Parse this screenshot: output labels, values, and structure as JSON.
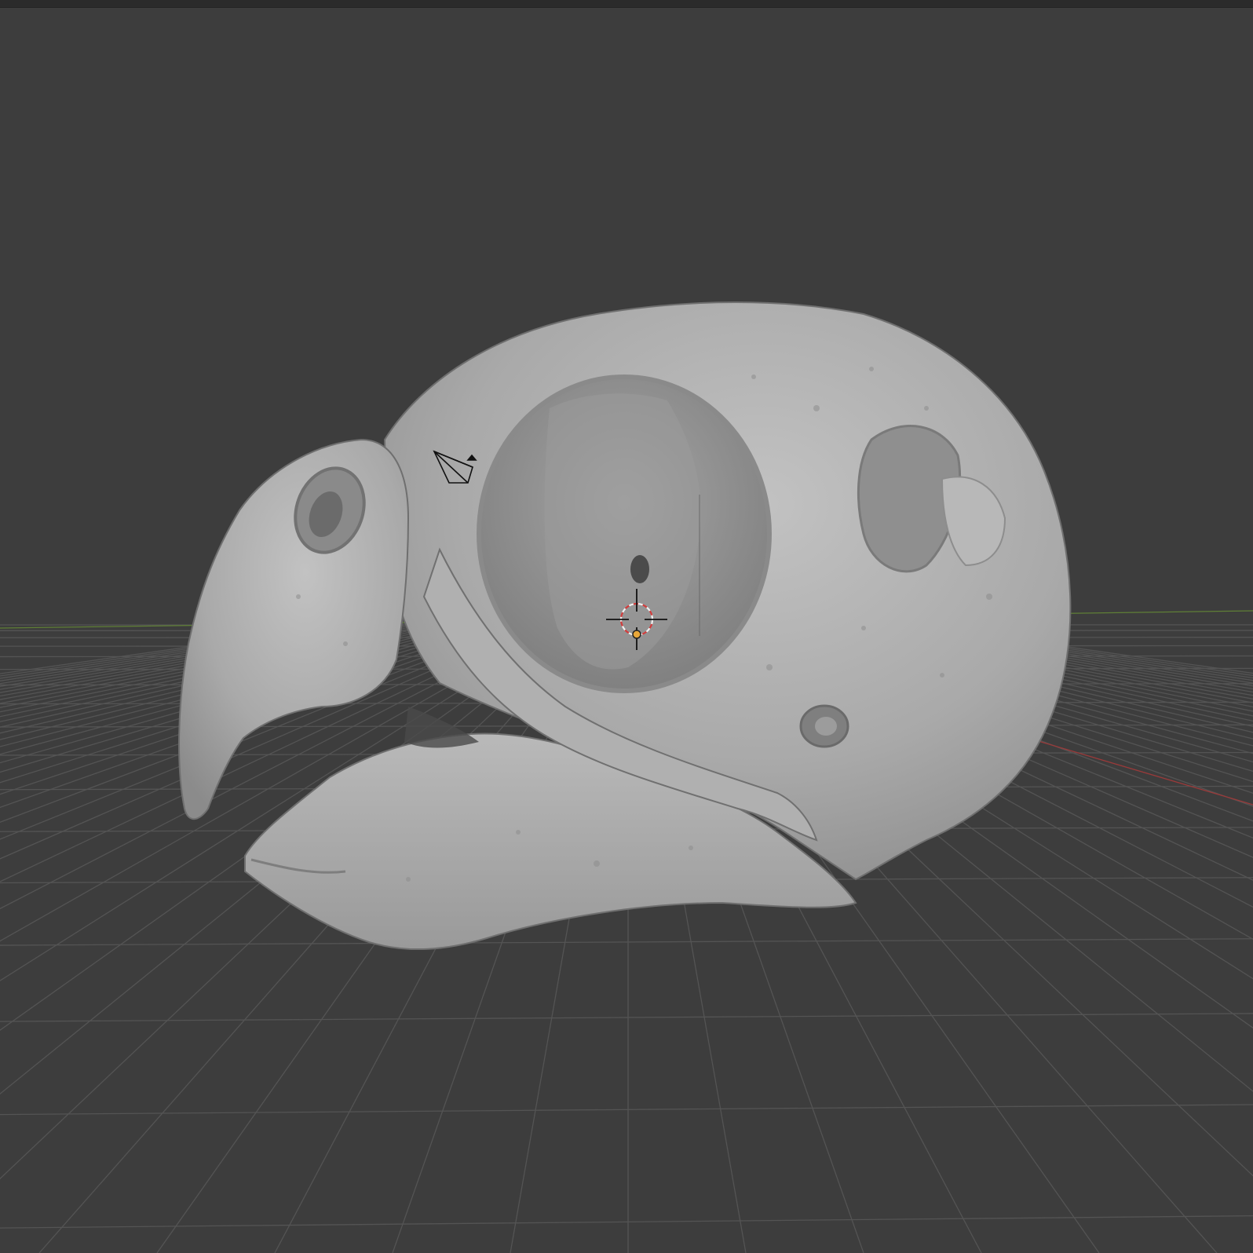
{
  "app": {
    "name": "3D viewport",
    "mode": "object",
    "shading": "solid"
  },
  "viewport": {
    "background_color": "#3d3d3d",
    "grid_color": "#545454",
    "x_axis_color": "#9a3a3a",
    "y_axis_color": "#5f7f36",
    "mesh_color": "#a9a9a9"
  },
  "scene": {
    "objects": [
      {
        "kind": "mesh",
        "icon": "skull-mesh",
        "selected": false
      },
      {
        "kind": "camera",
        "icon": "camera-icon",
        "selected": false
      },
      {
        "kind": "light",
        "icon": "light-icon",
        "selected": false
      }
    ],
    "cursor": {
      "icon": "3d-cursor-icon",
      "ring_colors": [
        "#d23c3c",
        "#f0f0f0"
      ]
    },
    "origin": {
      "icon": "origin-dot-icon",
      "color": "#e8a73a"
    }
  }
}
